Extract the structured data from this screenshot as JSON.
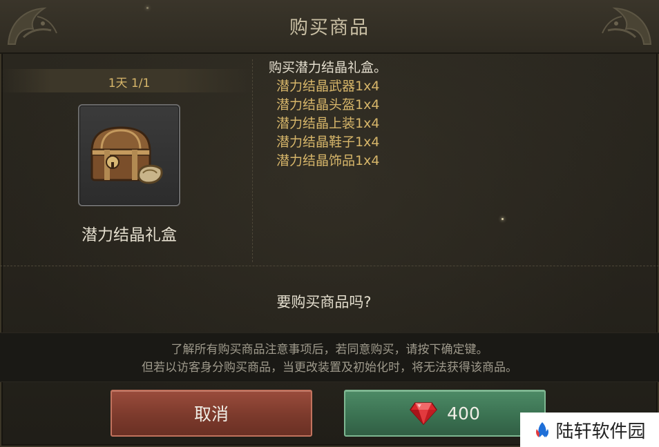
{
  "dialog": {
    "title": "购买商品",
    "quota": "1天 1/1",
    "item": {
      "name": "潜力结晶礼盒",
      "icon": "treasure-chest-icon"
    },
    "description": {
      "heading": "购买潜力结晶礼盒。",
      "contents": [
        "潜力结晶武器1x4",
        "潜力结晶头盔1x4",
        "潜力结晶上装1x4",
        "潜力结晶鞋子1x4",
        "潜力结晶饰品1x4"
      ]
    },
    "question": "要购买商品吗?",
    "notice": [
      "了解所有购买商品注意事项后，若同意购买，请按下确定键。",
      "但若以访客身分购买商品，当更改装置及初始化时，将无法获得该商品。"
    ],
    "buttons": {
      "cancel_label": "取消",
      "confirm_price": "400",
      "confirm_icon": "ruby-gem-icon"
    }
  },
  "watermark": {
    "text": "陆轩软件园"
  },
  "colors": {
    "gold_text": "#d7b66a",
    "cancel_button": "#7c3a2c",
    "confirm_button": "#3b7252"
  }
}
